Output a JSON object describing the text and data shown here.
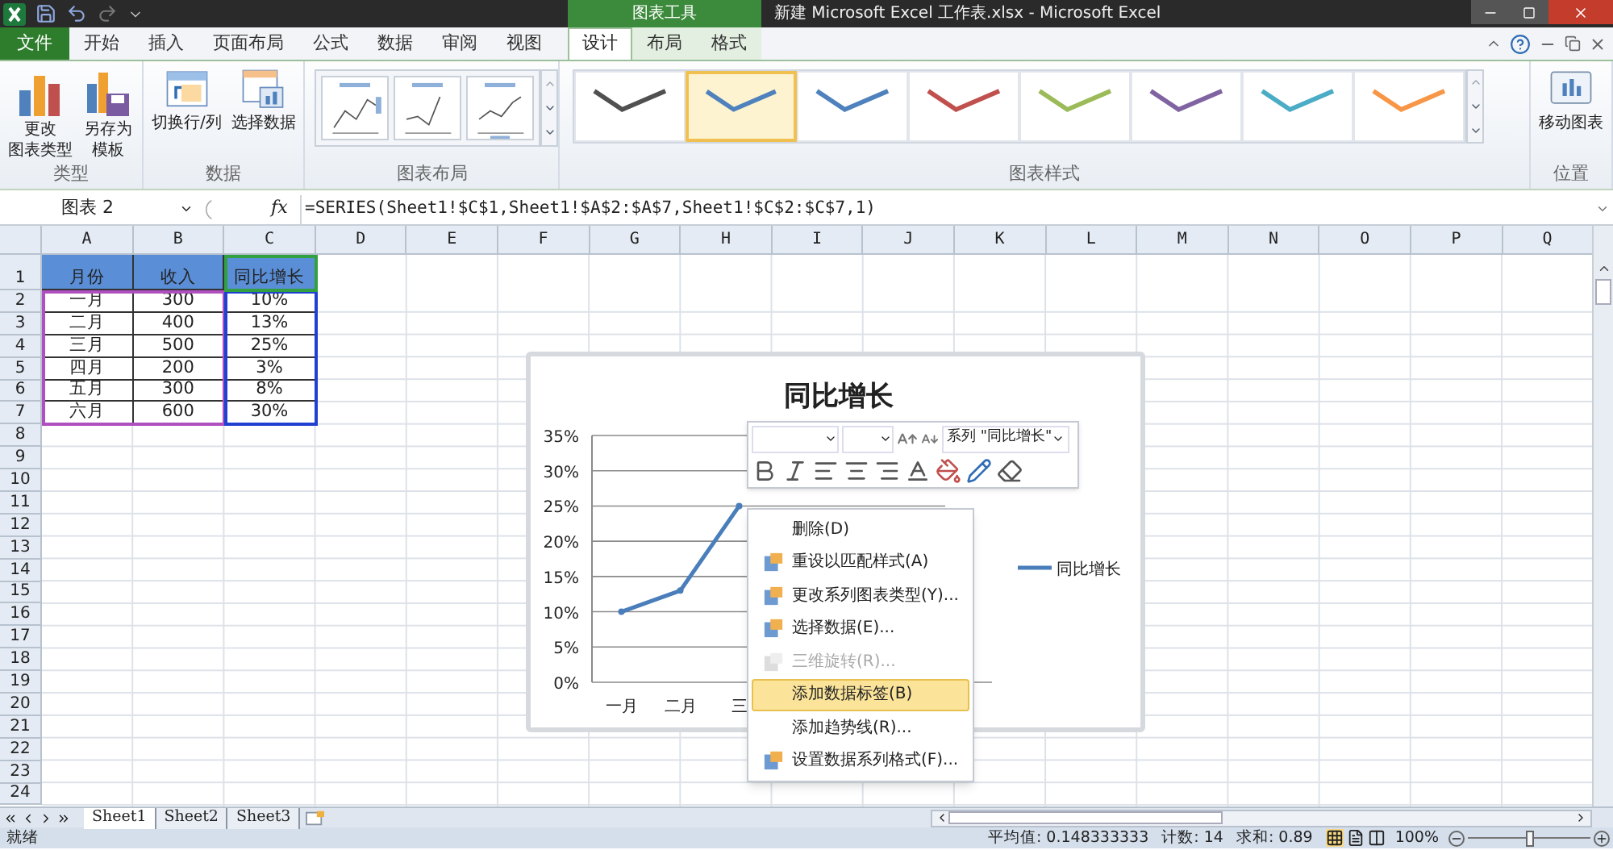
{
  "window": {
    "title": "新建 Microsoft Excel 工作表.xlsx  -  Microsoft Excel",
    "context_group": "图表工具"
  },
  "tabs": [
    {
      "label": "文件",
      "kind": "file",
      "selected": false
    },
    {
      "label": "开始",
      "kind": "tab",
      "selected": false
    },
    {
      "label": "插入",
      "kind": "tab",
      "selected": false
    },
    {
      "label": "页面布局",
      "kind": "tab",
      "selected": false
    },
    {
      "label": "公式",
      "kind": "tab",
      "selected": false
    },
    {
      "label": "数据",
      "kind": "tab",
      "selected": false
    },
    {
      "label": "审阅",
      "kind": "tab",
      "selected": false
    },
    {
      "label": "视图",
      "kind": "tab",
      "selected": false
    },
    {
      "label": "设计",
      "kind": "context",
      "selected": true
    },
    {
      "label": "布局",
      "kind": "context",
      "selected": false
    },
    {
      "label": "格式",
      "kind": "context",
      "selected": false
    }
  ],
  "ribbon": {
    "groups": [
      {
        "label": "类型",
        "kind": "buttons",
        "buttons": [
          {
            "lines": [
              "更改",
              "图表类型"
            ],
            "kind": "chart-type"
          },
          {
            "lines": [
              "另存为",
              "模板"
            ],
            "kind": "save-template"
          }
        ]
      },
      {
        "label": "数据",
        "kind": "buttons",
        "buttons": [
          {
            "lines": [
              "切换行/列"
            ],
            "kind": "switch"
          },
          {
            "lines": [
              "选择数据"
            ],
            "kind": "select-data"
          }
        ]
      },
      {
        "label": "图表布局",
        "kind": "layouts"
      },
      {
        "label": "图表样式",
        "kind": "styles",
        "styles": [
          {
            "color": "#505050",
            "selected": false
          },
          {
            "color": "#4f81bd",
            "selected": true
          },
          {
            "color": "#4f81bd",
            "selected": false
          },
          {
            "color": "#c0504d",
            "selected": false
          },
          {
            "color": "#9bbb59",
            "selected": false
          },
          {
            "color": "#8064a2",
            "selected": false
          },
          {
            "color": "#4bacc6",
            "selected": false
          },
          {
            "color": "#f79646",
            "selected": false
          }
        ]
      },
      {
        "label": "位置",
        "kind": "buttons",
        "buttons": [
          {
            "lines": [
              "移动图表"
            ],
            "kind": "move-chart"
          }
        ]
      }
    ]
  },
  "formula_bar": {
    "name_box": "图表 2",
    "fx_label": "fx",
    "formula": "=SERIES(Sheet1!$C$1,Sheet1!$A$2:$A$7,Sheet1!$C$2:$C$7,1)"
  },
  "sheet": {
    "columns": [
      "A",
      "B",
      "C",
      "D",
      "E",
      "F",
      "G",
      "H",
      "I",
      "J",
      "K",
      "L",
      "M",
      "N",
      "O",
      "P",
      "Q"
    ],
    "rows": [
      {
        "number": "1",
        "cells": [
          "月份",
          "收入",
          "同比增长"
        ]
      },
      {
        "number": "2",
        "cells": [
          "一月",
          "300",
          "10%"
        ]
      },
      {
        "number": "3",
        "cells": [
          "二月",
          "400",
          "13%"
        ]
      },
      {
        "number": "4",
        "cells": [
          "三月",
          "500",
          "25%"
        ]
      },
      {
        "number": "5",
        "cells": [
          "四月",
          "200",
          "3%"
        ]
      },
      {
        "number": "6",
        "cells": [
          "五月",
          "300",
          "8%"
        ]
      },
      {
        "number": "7",
        "cells": [
          "六月",
          "600",
          "30%"
        ]
      },
      {
        "number": "8"
      },
      {
        "number": "9"
      },
      {
        "number": "10"
      },
      {
        "number": "11"
      },
      {
        "number": "12"
      },
      {
        "number": "13"
      },
      {
        "number": "14"
      },
      {
        "number": "15"
      },
      {
        "number": "16"
      },
      {
        "number": "17"
      },
      {
        "number": "18"
      },
      {
        "number": "19"
      },
      {
        "number": "20"
      },
      {
        "number": "21"
      },
      {
        "number": "22"
      },
      {
        "number": "23"
      },
      {
        "number": "24"
      }
    ]
  },
  "chart": {
    "chart_data": {
      "type": "line",
      "title": "同比增长",
      "categories": [
        "一月",
        "二月",
        "三",
        null,
        null,
        null
      ],
      "grid": true,
      "series": [
        {
          "name": "同比增长",
          "color": "#4a7ebb",
          "marker": true,
          "values": [
            0.1,
            0.13,
            0.25,
            null,
            null,
            null
          ]
        }
      ],
      "ylim": [
        0,
        0.35
      ],
      "yticks": [
        {
          "value": 0,
          "label": "0%"
        },
        {
          "value": 0.05,
          "label": "5%"
        },
        {
          "value": 0.1,
          "label": "10%"
        },
        {
          "value": 0.15,
          "label": "15%"
        },
        {
          "value": 0.2,
          "label": "20%"
        },
        {
          "value": 0.25,
          "label": "25%"
        },
        {
          "value": 0.3,
          "label": "30%"
        },
        {
          "value": 0.35,
          "label": "35%"
        }
      ]
    }
  },
  "mini_toolbar": {
    "series_picker": "系列 \"同比增长\""
  },
  "context_menu": [
    {
      "label": "删除(D)",
      "kind": "plain",
      "disabled": false,
      "selected": false
    },
    {
      "label": "重设以匹配样式(A)",
      "kind": "icon",
      "disabled": false,
      "selected": false
    },
    {
      "label": "更改系列图表类型(Y)...",
      "kind": "icon",
      "disabled": false,
      "selected": false
    },
    {
      "label": "选择数据(E)...",
      "kind": "icon",
      "disabled": false,
      "selected": false
    },
    {
      "label": "三维旋转(R)...",
      "kind": "icon",
      "disabled": true,
      "selected": false
    },
    {
      "label": "添加数据标签(B)",
      "kind": "plain",
      "disabled": false,
      "selected": true
    },
    {
      "label": "添加趋势线(R)...",
      "kind": "plain",
      "disabled": false,
      "selected": false
    },
    {
      "label": "设置数据系列格式(F)...",
      "kind": "icon",
      "disabled": false,
      "selected": false
    }
  ],
  "sheet_tabs": [
    {
      "label": "Sheet1",
      "selected": true
    },
    {
      "label": "Sheet2",
      "selected": false
    },
    {
      "label": "Sheet3",
      "selected": false
    }
  ],
  "status_bar": {
    "mode": "就绪",
    "average": "平均值: 0.148333333",
    "count": "计数: 14",
    "sum": "求和: 0.89",
    "zoom": "100%",
    "zoom_slider": {
      "level": 0.5
    }
  }
}
